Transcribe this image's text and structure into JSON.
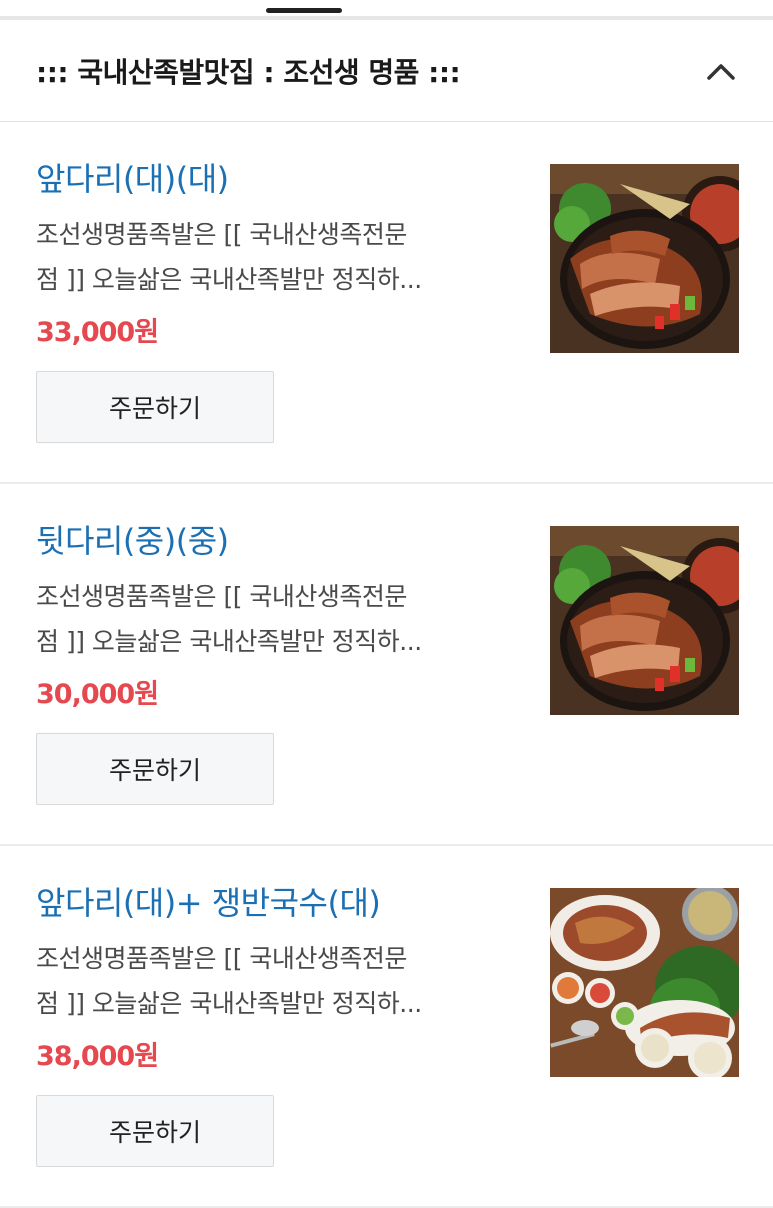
{
  "section": {
    "title": "::: 국내산족발맛집 : 조선생 명품 :::",
    "collapse_icon": "chevron-up-icon"
  },
  "items": [
    {
      "name": "앞다리(대)(대)",
      "desc_line1": "조선생명품족발은 [[ 국내산생족전문",
      "desc_line2": "점 ]] 오늘삶은 국내산족발만 정직하...",
      "price": "33,000원",
      "order_label": "주문하기",
      "image": "jokbal-platter-photo"
    },
    {
      "name": "뒷다리(중)(중)",
      "desc_line1": "조선생명품족발은 [[ 국내산생족전문",
      "desc_line2": "점 ]] 오늘삶은 국내산족발만 정직하...",
      "price": "30,000원",
      "order_label": "주문하기",
      "image": "jokbal-platter-photo"
    },
    {
      "name": "앞다리(대)+ 쟁반국수(대)",
      "desc_line1": "조선생명품족발은 [[ 국내산생족전문",
      "desc_line2": "점 ]] 오늘삶은 국내산족발만 정직하...",
      "price": "38,000원",
      "order_label": "주문하기",
      "image": "jokbal-noodle-set-photo"
    }
  ],
  "colors": {
    "item_name": "#1b6fb3",
    "price": "#e5484f",
    "button_bg": "#f6f7f9"
  }
}
